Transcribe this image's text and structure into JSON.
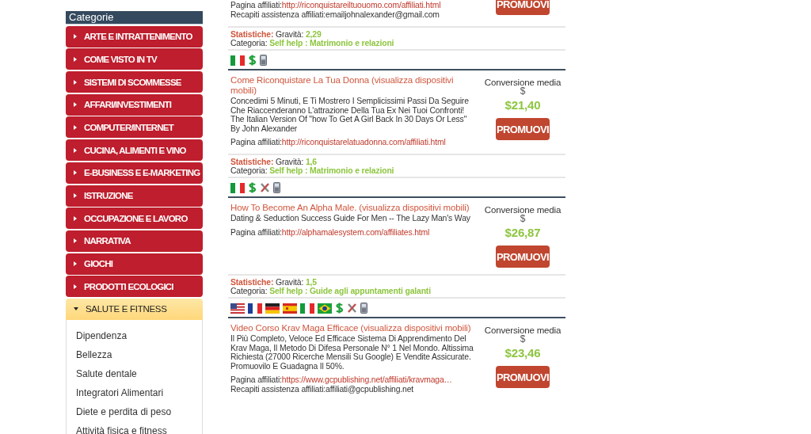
{
  "sidebar": {
    "title": "Categorie",
    "items": [
      {
        "label": "ARTE E INTRATTENIMENTO",
        "expanded": false
      },
      {
        "label": "COME VISTO IN TV",
        "expanded": false
      },
      {
        "label": "SISTEMI DI SCOMMESSE",
        "expanded": false
      },
      {
        "label": "AFFARI/INVESTIMENTI",
        "expanded": false
      },
      {
        "label": "COMPUTER/INTERNET",
        "expanded": false
      },
      {
        "label": "CUCINA, ALIMENTI E VINO",
        "expanded": false
      },
      {
        "label": "E-BUSINESS E E-MARKETING",
        "expanded": false
      },
      {
        "label": "ISTRUZIONE",
        "expanded": false
      },
      {
        "label": "OCCUPAZIONE E LAVORO",
        "expanded": false
      },
      {
        "label": "NARRATIVA",
        "expanded": false
      },
      {
        "label": "GIOCHI",
        "expanded": false
      },
      {
        "label": "PRODOTTI ECOLOGICI",
        "expanded": false
      },
      {
        "label": "SALUTE E FITNESS",
        "expanded": true,
        "children": [
          "Dipendenza",
          "Bellezza",
          "Salute dentale",
          "Integratori Alimentari",
          "Diete e perdita di peso",
          "Attività fisica e fitness"
        ]
      }
    ]
  },
  "products": [
    {
      "affiliate_label": "Pagina affiliati:",
      "affiliate_url": "http://riconquistareiltuouomo.com/affiliati.html",
      "support_label": "Recapiti assistenza affiliati:",
      "support_value": "emailjohnalexander@gmail.com",
      "button": "PROMUOVI",
      "stats_label": "Statistiche:",
      "gravity_label": "Gravità:",
      "gravity": "2,29",
      "category_label": "Categoria:",
      "category": "Self help : Matrimonio e relazioni",
      "icons": [
        {
          "kind": "it"
        },
        {
          "kind": "dollar"
        },
        {
          "kind": "mobile"
        }
      ]
    },
    {
      "title": "Come Riconquistare La Tua Donna (visualizza dispositivi mobili)",
      "description": "Concedimi 5 Minuti, E Ti Mostrero I Semplicissimi Passi Da Seguire Che Riaccenderanno L'attrazione Della Tua Ex Nei Tuoi Confronti! The Italian Version Of \"how To Get A Girl Back In 30 Days Or Less\" By John Alexander",
      "affiliate_label": "Pagina affiliati:",
      "affiliate_url": "http://riconquistarelatuadonna.com/affiliati.html",
      "conversion_label": "Conversione media",
      "currency": "$",
      "amount": "$21,40",
      "button": "PROMUOVI",
      "stats_label": "Statistiche:",
      "gravity_label": "Gravità:",
      "gravity": "1,6",
      "category_label": "Categoria:",
      "category": "Self help : Matrimonio e relazioni",
      "icons": [
        {
          "kind": "it"
        },
        {
          "kind": "dollar"
        },
        {
          "kind": "tools"
        },
        {
          "kind": "mobile"
        }
      ]
    },
    {
      "title": "How To Become An Alpha Male. (visualizza dispositivi mobili)",
      "description": "Dating & Seduction Success Guide For Men -- The Lazy Man's Way",
      "affiliate_label": "Pagina affiliati:",
      "affiliate_url": "http://alphamalesystem.com/affiliates.html",
      "conversion_label": "Conversione media",
      "currency": "$",
      "amount": "$26,87",
      "button": "PROMUOVI",
      "stats_label": "Statistiche:",
      "gravity_label": "Gravità:",
      "gravity": "1,5",
      "category_label": "Categoria:",
      "category": "Self help : Guide agli appuntamenti galanti",
      "icons": [
        {
          "kind": "us"
        },
        {
          "kind": "fr"
        },
        {
          "kind": "de"
        },
        {
          "kind": "es"
        },
        {
          "kind": "it"
        },
        {
          "kind": "br"
        },
        {
          "kind": "dollar"
        },
        {
          "kind": "tools"
        },
        {
          "kind": "mobile"
        }
      ]
    },
    {
      "title": "Video Corso Krav Maga Efficace (visualizza dispositivi mobili)",
      "description": "Il Più Completo, Veloce Ed Efficace Sistema Di Apprendimento Del Krav Maga, Il Metodo Di Difesa Personale N° 1 Nel Mondo. Altissima Richiesta (27000 Ricerche Mensili Su Google) E Vendite Assicurate. Promuovilo E Guadagna Il 50%.",
      "affiliate_label": "Pagina affiliati:",
      "affiliate_url": "https://www.gcpublishing.net/affiliati/kravmaga…",
      "support_label": "Recapiti assistenza affiliati:",
      "support_value": "affiliati@gcpublishing.net",
      "conversion_label": "Conversione media",
      "currency": "$",
      "amount": "$23,46",
      "button": "PROMUOVI"
    }
  ]
}
